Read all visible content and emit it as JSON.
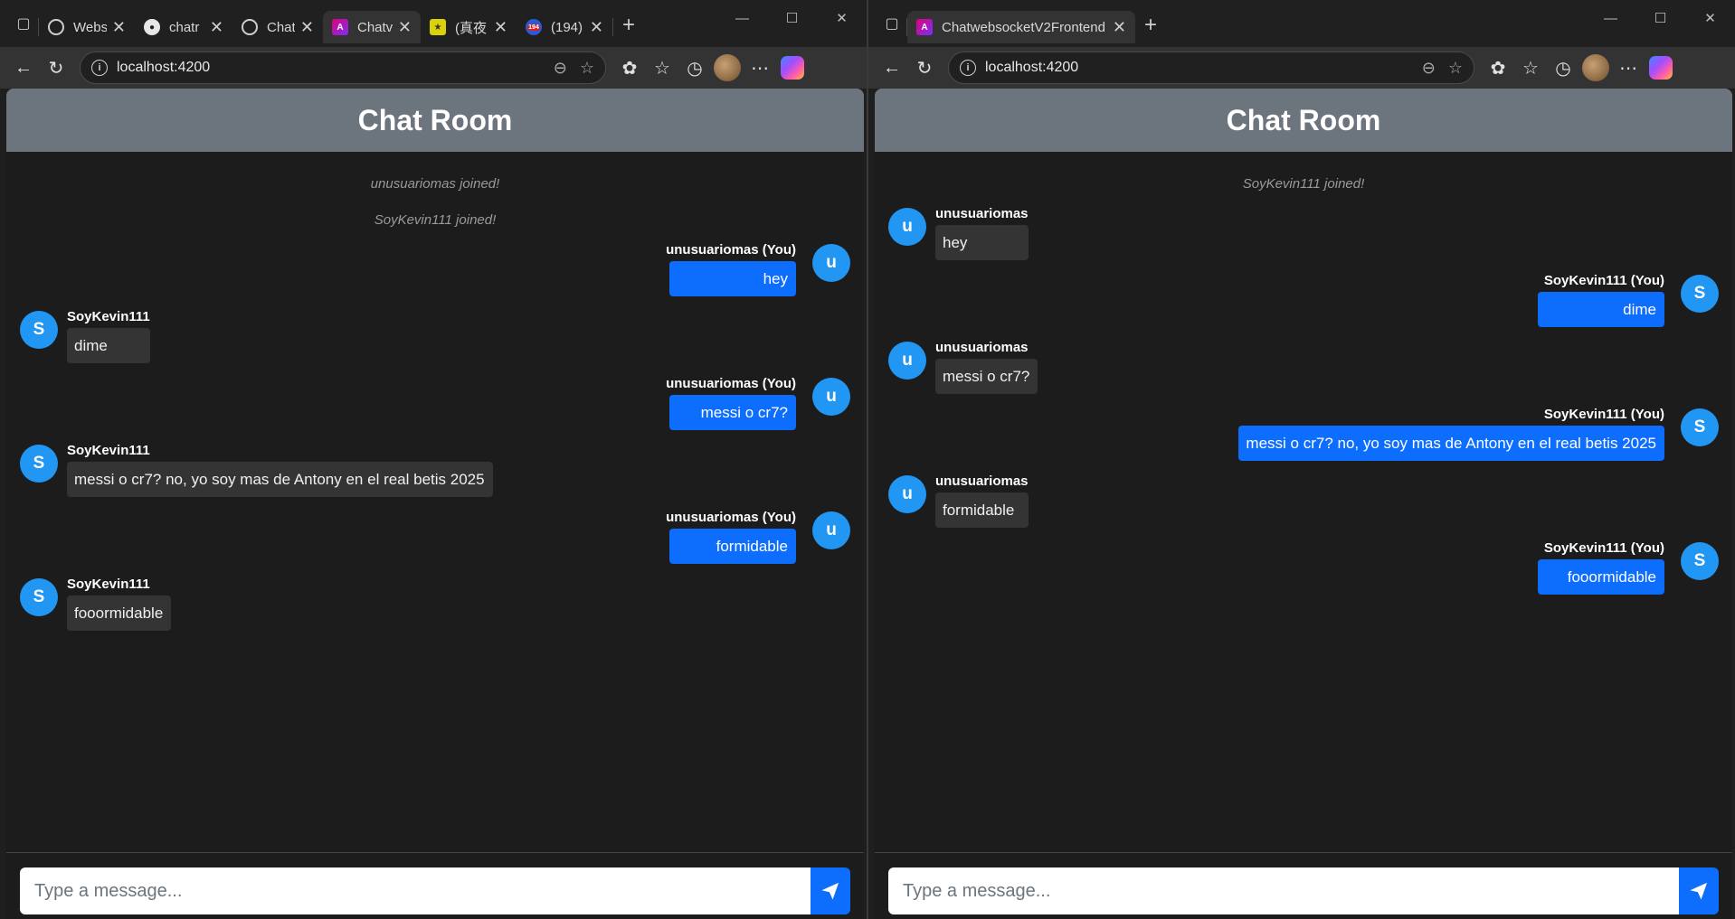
{
  "colors": {
    "accent": "#0d6efd",
    "avatar": "#2196f3",
    "header_bg": "#6c757d",
    "page_bg": "#1c1c1d"
  },
  "left": {
    "tabs": [
      {
        "title": "Webs",
        "icon": "openai-icon"
      },
      {
        "title": "chatr",
        "icon": "github-icon"
      },
      {
        "title": "Chat",
        "icon": "openai-icon"
      },
      {
        "title": "Chatv",
        "icon": "angular-icon",
        "active": true
      },
      {
        "title": "(真夜",
        "icon": "star-icon"
      },
      {
        "title": "(194)",
        "icon": "notification-icon",
        "badge": "194"
      }
    ],
    "url": "localhost:4200",
    "chat_title": "Chat Room",
    "system_messages": [
      "unusuariomas joined!",
      "SoyKevin111 joined!"
    ],
    "messages": [
      {
        "sender": "unusuariomas (You)",
        "initial": "u",
        "text": "hey",
        "mine": true
      },
      {
        "sender": "SoyKevin111",
        "initial": "S",
        "text": "dime",
        "mine": false
      },
      {
        "sender": "unusuariomas (You)",
        "initial": "u",
        "text": "messi o cr7?",
        "mine": true
      },
      {
        "sender": "SoyKevin111",
        "initial": "S",
        "text": "messi o cr7? no, yo soy mas de Antony en el real betis 2025",
        "mine": false
      },
      {
        "sender": "unusuariomas (You)",
        "initial": "u",
        "text": "formidable",
        "mine": true
      },
      {
        "sender": "SoyKevin111",
        "initial": "S",
        "text": "fooormidable",
        "mine": false
      }
    ],
    "input_placeholder": "Type a message..."
  },
  "right": {
    "tabs": [
      {
        "title": "ChatwebsocketV2Frontend",
        "icon": "angular-icon",
        "active": true
      }
    ],
    "url": "localhost:4200",
    "chat_title": "Chat Room",
    "system_messages": [
      "SoyKevin111 joined!"
    ],
    "messages": [
      {
        "sender": "unusuariomas",
        "initial": "u",
        "text": "hey",
        "mine": false
      },
      {
        "sender": "SoyKevin111 (You)",
        "initial": "S",
        "text": "dime",
        "mine": true
      },
      {
        "sender": "unusuariomas",
        "initial": "u",
        "text": "messi o cr7?",
        "mine": false
      },
      {
        "sender": "SoyKevin111 (You)",
        "initial": "S",
        "text": "messi o cr7? no, yo soy mas de Antony en el real betis 2025",
        "mine": true
      },
      {
        "sender": "unusuariomas",
        "initial": "u",
        "text": "formidable",
        "mine": false
      },
      {
        "sender": "SoyKevin111 (You)",
        "initial": "S",
        "text": "fooormidable",
        "mine": true
      }
    ],
    "input_placeholder": "Type a message..."
  }
}
